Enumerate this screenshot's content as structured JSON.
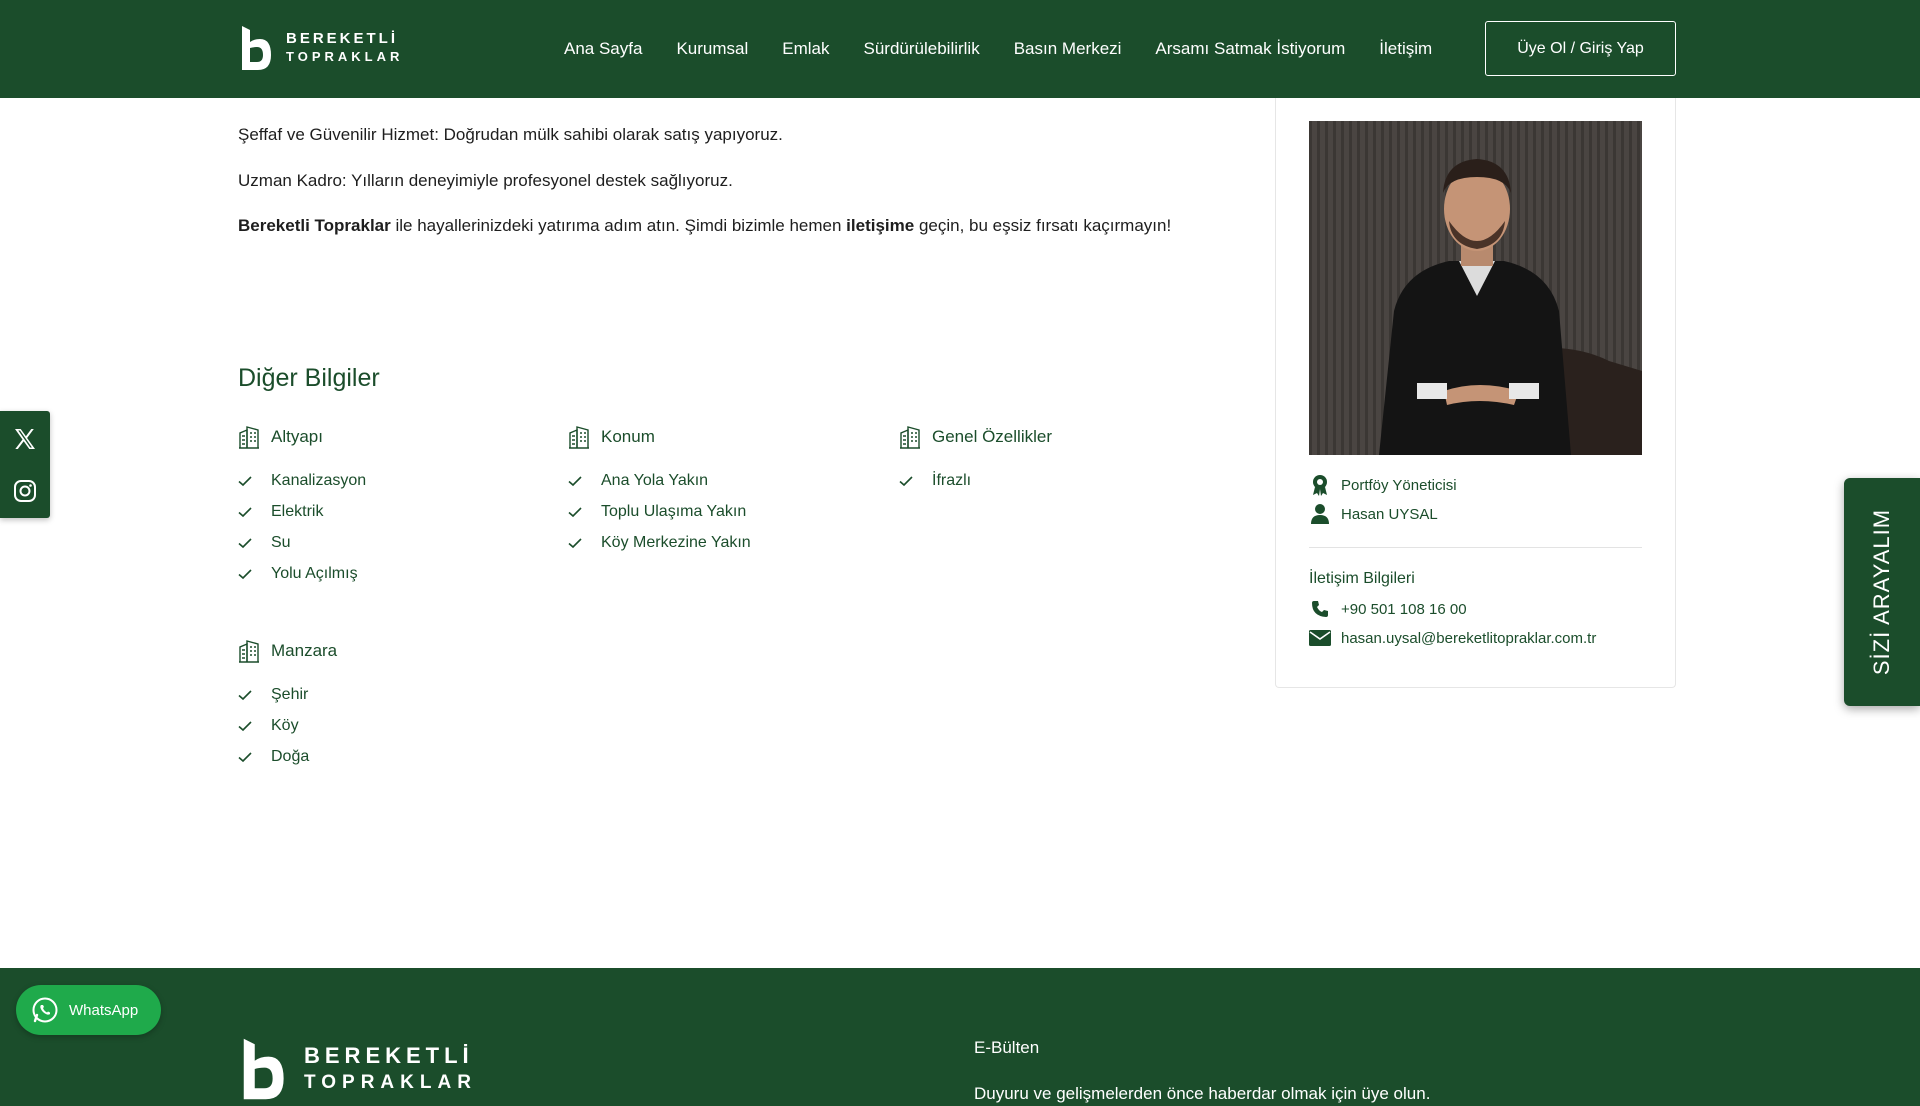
{
  "header": {
    "logo_line1": "BEREKETLİ",
    "logo_line2": "TOPRAKLAR",
    "nav": [
      "Ana Sayfa",
      "Kurumsal",
      "Emlak",
      "Sürdürülebilirlik",
      "Basın Merkezi",
      "Arsamı Satmak İstiyorum",
      "İletişim"
    ],
    "login_label": "Üye Ol / Giriş Yap"
  },
  "content": {
    "p1": "Şeffaf ve Güvenilir Hizmet: Doğrudan mülk sahibi olarak satış yapıyoruz.",
    "p2": "Uzman Kadro: Yılların deneyimiyle profesyonel destek sağlıyoruz.",
    "p3_bold1": "Bereketli Topraklar",
    "p3_mid": " ile hayallerinizdeki yatırıma adım atın. Şimdi bizimle hemen ",
    "p3_bold2": "iletişime",
    "p3_end": " geçin, bu eşsiz fırsatı kaçırmayın!"
  },
  "other_info": {
    "title": "Diğer Bilgiler",
    "groups": [
      {
        "title": "Altyapı",
        "items": [
          "Kanalizasyon",
          "Elektrik",
          "Su",
          "Yolu Açılmış"
        ]
      },
      {
        "title": "Konum",
        "items": [
          "Ana Yola Yakın",
          "Toplu Ulaşıma Yakın",
          "Köy Merkezine Yakın"
        ]
      },
      {
        "title": "Genel Özellikler",
        "items": [
          "İfrazlı"
        ]
      },
      {
        "title": "Manzara",
        "items": [
          "Şehir",
          "Köy",
          "Doğa"
        ]
      }
    ]
  },
  "agent": {
    "role": "Portföy Yöneticisi",
    "name": "Hasan UYSAL",
    "contact_title": "İletişim Bilgileri",
    "phone": "+90 501 108 16 00",
    "email": "hasan.uysal@bereketlitopraklar.com.tr"
  },
  "call_tab": "SİZİ ARAYALIM",
  "whatsapp_label": "WhatsApp",
  "footer": {
    "logo_line1": "BEREKETLİ",
    "logo_line2": "TOPRAKLAR",
    "ebulten_title": "E-Bülten",
    "ebulten_desc": "Duyuru ve gelişmelerden önce haberdar olmak için üye olun."
  },
  "colors": {
    "brand_green": "#1b4d2b",
    "whatsapp_green": "#1faa4b"
  },
  "icons": [
    "building-icon",
    "check-icon",
    "award-icon",
    "user-icon",
    "phone-icon",
    "mail-icon",
    "x-twitter-icon",
    "instagram-icon",
    "whatsapp-icon"
  ]
}
